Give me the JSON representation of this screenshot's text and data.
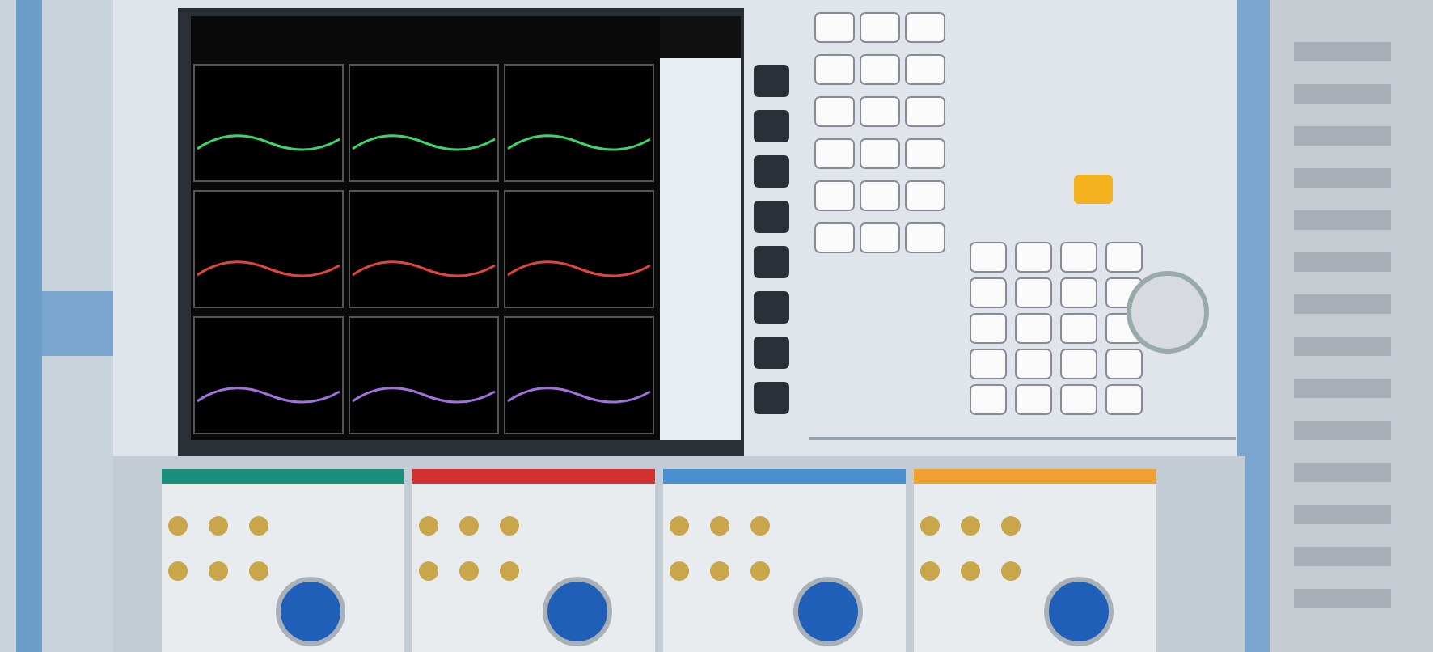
{
  "photo": {
    "kind": "instrument"
  }
}
